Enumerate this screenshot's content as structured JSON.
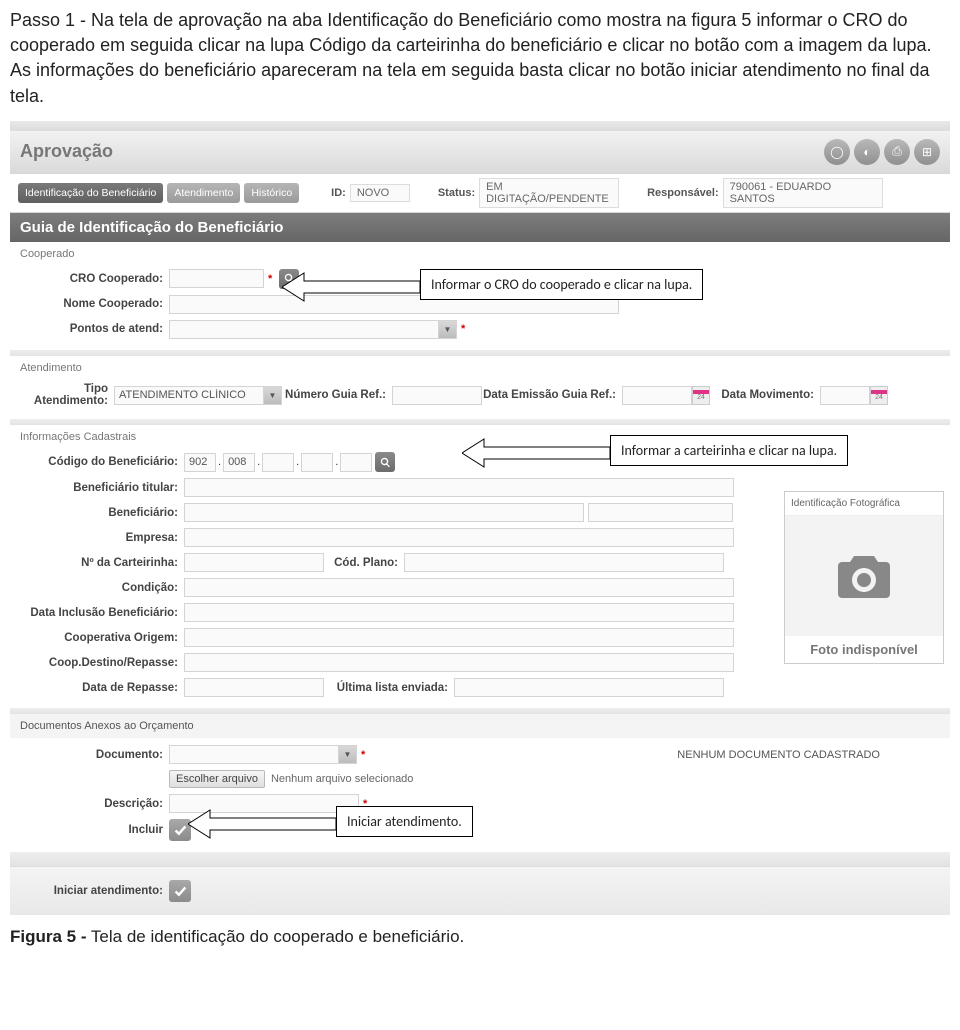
{
  "doc": {
    "instructions": "Passo 1 - Na tela de aprovação na aba Identificação do Beneficiário como mostra na figura 5 informar o CRO do cooperado em seguida clicar na lupa Código da carteirinha do beneficiário e clicar no botão com a imagem da lupa. As informações do beneficiário apareceram na tela em seguida basta clicar no botão iniciar atendimento no final da tela.",
    "figure_caption": "Figura 5 - Tela de identificação do cooperado e beneficiário."
  },
  "callouts": {
    "c1": "Informar o CRO do cooperado e clicar na lupa.",
    "c2": "Informar a carteirinha e clicar na lupa.",
    "c3": "Iniciar atendimento."
  },
  "app": {
    "title": "Aprovação",
    "section_title": "Guia de Identificação do Beneficiário",
    "tabs": {
      "t1": "Identificação do Beneficiário",
      "t2": "Atendimento",
      "t3": "Histórico"
    },
    "header_info": {
      "id_label": "ID:",
      "id_value": "NOVO",
      "status_label": "Status:",
      "status_value": "EM DIGITAÇÃO/PENDENTE",
      "resp_label": "Responsável:",
      "resp_value": "790061 - EDUARDO SANTOS"
    },
    "cooperado": {
      "legend": "Cooperado",
      "cro_label": "CRO Cooperado:",
      "nome_label": "Nome Cooperado:",
      "pontos_label": "Pontos de atend:"
    },
    "atendimento": {
      "legend": "Atendimento",
      "tipo_label": "Tipo Atendimento:",
      "tipo_value": "ATENDIMENTO CLÍNICO",
      "numguia_label": "Número Guia Ref.:",
      "dataemissao_label": "Data Emissão Guia Ref.:",
      "datamov_label": "Data Movimento:"
    },
    "infocad": {
      "legend": "Informações Cadastrais",
      "codigo_label": "Código do Beneficiário:",
      "cod_p1": "902",
      "cod_p2": "008",
      "titular_label": "Beneficiário titular:",
      "benef_label": "Beneficiário:",
      "empresa_label": "Empresa:",
      "carteirinha_label": "Nº da Carteirinha:",
      "codplano_label": "Cód. Plano:",
      "condicao_label": "Condição:",
      "inclusao_label": "Data Inclusão Beneficiário:",
      "cooporig_label": "Cooperativa Origem:",
      "coopdest_label": "Coop.Destino/Repasse:",
      "datarepasse_label": "Data de Repasse:",
      "ultima_label": "Última lista enviada:",
      "photo_head": "Identificação Fotográfica",
      "photo_cap": "Foto indisponível"
    },
    "docs": {
      "legend": "Documentos Anexos ao Orçamento",
      "documento_label": "Documento:",
      "filebtn": "Escolher arquivo",
      "nofile": "Nenhum arquivo selecionado",
      "nodoc": "NENHUM DOCUMENTO CADASTRADO",
      "descricao_label": "Descrição:",
      "incluir_label": "Incluir"
    },
    "footer": {
      "iniciar_label": "Iniciar atendimento:"
    }
  }
}
